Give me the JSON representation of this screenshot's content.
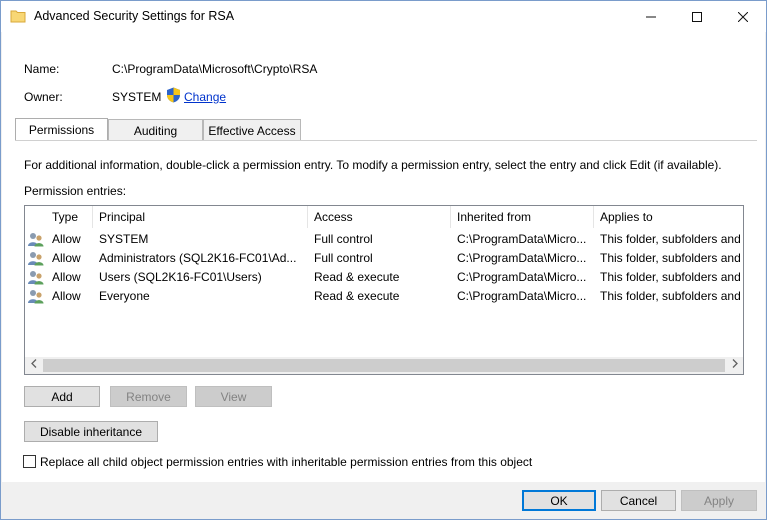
{
  "window": {
    "title": "Advanced Security Settings for RSA",
    "controls": {
      "minimize": "—",
      "maximize": "☐",
      "close": "✕"
    }
  },
  "details": {
    "name_label": "Name:",
    "name_value": "C:\\ProgramData\\Microsoft\\Crypto\\RSA",
    "owner_label": "Owner:",
    "owner_value": "SYSTEM",
    "change_link": "Change"
  },
  "tabs": [
    {
      "label": "Permissions",
      "active": true
    },
    {
      "label": "Auditing",
      "active": false
    },
    {
      "label": "Effective Access",
      "active": false
    }
  ],
  "permissions": {
    "info_text": "For additional information, double-click a permission entry. To modify a permission entry, select the entry and click Edit (if available).",
    "entries_label": "Permission entries:",
    "columns": [
      "Type",
      "Principal",
      "Access",
      "Inherited from",
      "Applies to"
    ],
    "rows": [
      {
        "type": "Allow",
        "principal": "SYSTEM",
        "access": "Full control",
        "inherited": "C:\\ProgramData\\Micro...",
        "applies": "This folder, subfolders and"
      },
      {
        "type": "Allow",
        "principal": "Administrators (SQL2K16-FC01\\Ad...",
        "access": "Full control",
        "inherited": "C:\\ProgramData\\Micro...",
        "applies": "This folder, subfolders and"
      },
      {
        "type": "Allow",
        "principal": "Users (SQL2K16-FC01\\Users)",
        "access": "Read & execute",
        "inherited": "C:\\ProgramData\\Micro...",
        "applies": "This folder, subfolders and"
      },
      {
        "type": "Allow",
        "principal": "Everyone",
        "access": "Read & execute",
        "inherited": "C:\\ProgramData\\Micro...",
        "applies": "This folder, subfolders and"
      }
    ]
  },
  "buttons": {
    "add": "Add",
    "remove": "Remove",
    "view": "View",
    "disable_inheritance": "Disable inheritance",
    "ok": "OK",
    "cancel": "Cancel",
    "apply": "Apply"
  },
  "replace_checkbox": {
    "label": "Replace all child object permission entries with inheritable permission entries from this object",
    "checked": false
  },
  "colors": {
    "link": "#0033cc",
    "accent": "#0078d7",
    "window_border": "#7a9ccb"
  },
  "icons": {
    "title": "folder-icon",
    "owner": "uac-shield-icon",
    "row": "users-group-icon"
  }
}
